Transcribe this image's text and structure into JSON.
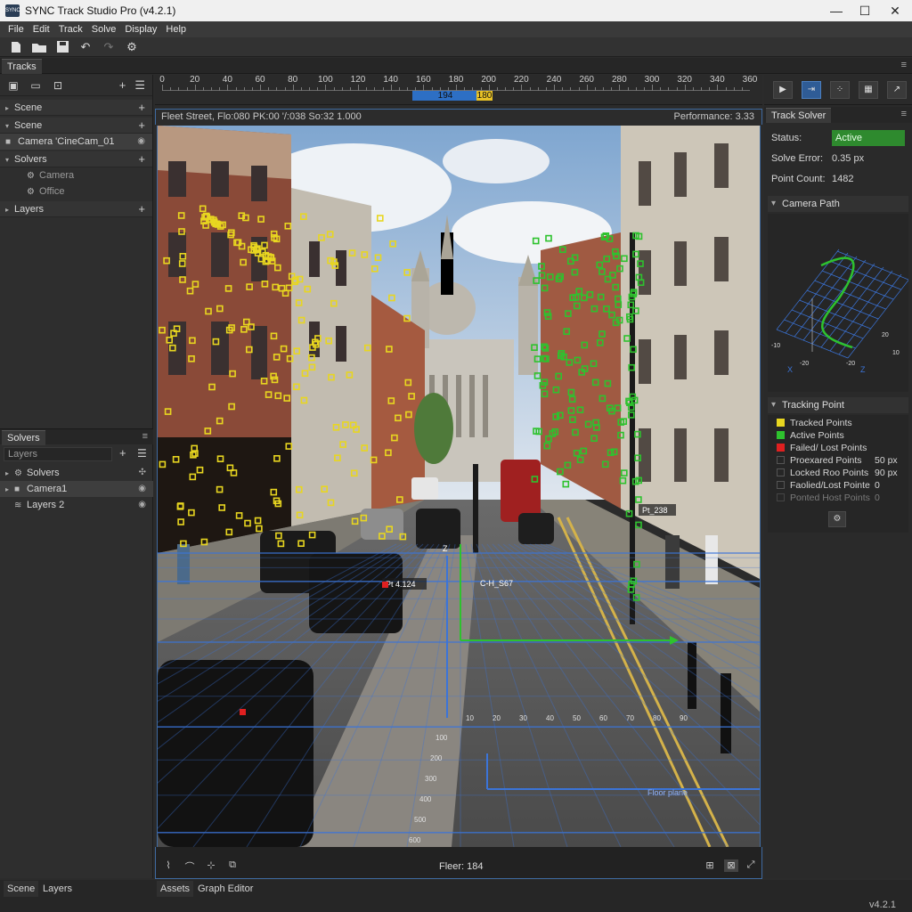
{
  "window": {
    "title": "SYNC Track Studio Pro  (v4.2.1)",
    "icon_text": "SYNC"
  },
  "menu": [
    "File",
    "Edit",
    "Track",
    "Solve",
    "Display",
    "Help"
  ],
  "toolbar": {
    "icons": [
      "new-file-icon",
      "open-folder-icon",
      "save-icon",
      "undo-icon",
      "redo-icon",
      "settings-gear-icon"
    ]
  },
  "main_tab": "Tracks",
  "left_panel": {
    "tree": [
      {
        "type": "section",
        "label": "Scene"
      },
      {
        "type": "section",
        "label": "Scene"
      },
      {
        "type": "item",
        "label": "Camera 'CineCam_01"
      },
      {
        "type": "section",
        "label": "Solvers"
      },
      {
        "type": "sub",
        "label": "Camera"
      },
      {
        "type": "sub",
        "label": "Office"
      },
      {
        "type": "section",
        "label": "Layers"
      }
    ],
    "lower_tab": "Solvers",
    "search_placeholder": "Layers",
    "lower_tree": [
      {
        "label": "Solvers"
      },
      {
        "label": "Camera1"
      },
      {
        "label": "Layers 2"
      }
    ]
  },
  "timeline": {
    "ticks": [
      "0",
      "20",
      "40",
      "60",
      "80",
      "100",
      "120",
      "140",
      "160",
      "180",
      "200",
      "220",
      "240",
      "260",
      "280",
      "300",
      "320",
      "340",
      "360"
    ],
    "range_label": "194",
    "current_label": "180"
  },
  "viewport": {
    "header_left": "Fleet Street, Flo:080    PK:00    '/:038    So:32  1.000",
    "performance": "Performance: 3.33",
    "labels": {
      "track_a": "Pt 4.124",
      "track_b": "Pt_238",
      "track_c": "C-H_S67",
      "floor_plane": "Floor plane",
      "axis_z": "Z"
    },
    "ground_numbers": [
      "10",
      "20",
      "30",
      "40",
      "50",
      "60",
      "70",
      "80",
      "90"
    ],
    "depth_numbers": [
      "100",
      "200",
      "300",
      "400",
      "500",
      "600"
    ],
    "footer_frame": "Fleer: 184"
  },
  "right_panel": {
    "tab": "Track Solver",
    "status_label": "Status:",
    "status_value": "Active",
    "solve_error_label": "Solve Error:",
    "solve_error_value": "0.35 px",
    "point_count_label": "Point Count:",
    "point_count_value": "1482",
    "camera_path_title": "Camera Path",
    "camera_path_axes": {
      "x": "X",
      "z": "Z",
      "ticks": [
        "-20",
        "-20",
        "20",
        "-10",
        "10"
      ]
    },
    "tracking_point_title": "Tracking Point",
    "legend": [
      {
        "label": "Tracked Points",
        "color": "#e8d620",
        "value": ""
      },
      {
        "label": "Active Points",
        "color": "#2ec22e",
        "value": ""
      },
      {
        "label": "Failed/ Lost Points",
        "color": "#e02020",
        "value": ""
      },
      {
        "label": "Proexared Points",
        "color": "",
        "value": "50 px"
      },
      {
        "label": "Locked Roo Points",
        "color": "",
        "value": "90 px"
      },
      {
        "label": "Faolied/Lost Pointe",
        "color": "",
        "value": "0"
      },
      {
        "label": "Ponted Host Points",
        "color": "",
        "value": "0"
      }
    ]
  },
  "bottom": {
    "left_tabs": [
      "Scene",
      "Layers"
    ],
    "center_tabs": [
      "Assets",
      "Graph Editor"
    ],
    "version": "v4.2.1"
  },
  "colors": {
    "accent_blue": "#2d6fc4",
    "track_yellow": "#e8d620",
    "track_green": "#2ec22e",
    "status_green": "#2e8a2e"
  }
}
